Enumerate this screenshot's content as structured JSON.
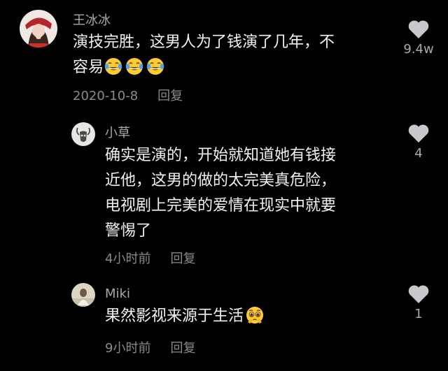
{
  "comments": [
    {
      "user": "王冰冰",
      "lines": [
        "演技完胜，这男人为了钱演了几年，不",
        "容易"
      ],
      "emoji": "face-with-tears-of-joy",
      "date": "2020-10-8",
      "reply": "回复",
      "likes": "9.4w"
    },
    {
      "user": "小草",
      "lines": [
        "确实是演的，开始就知道她有钱接",
        "近他，这男的做的太完美真危险，",
        "电视剧上完美的爱情在现实中就要",
        "警惕了"
      ],
      "date": "4小时前",
      "reply": "回复",
      "likes": "4"
    },
    {
      "user": "Miki",
      "lines": [
        "果然影视来源于生活"
      ],
      "emoji": "pleading-face",
      "date": "9小时前",
      "reply": "回复",
      "likes": "1"
    }
  ],
  "colors": {
    "background": "#000000",
    "username": "#a9a9ad",
    "body_text": "#f2f2f2",
    "meta_text": "#8a8a8e",
    "heart": "#c9c9cd"
  }
}
